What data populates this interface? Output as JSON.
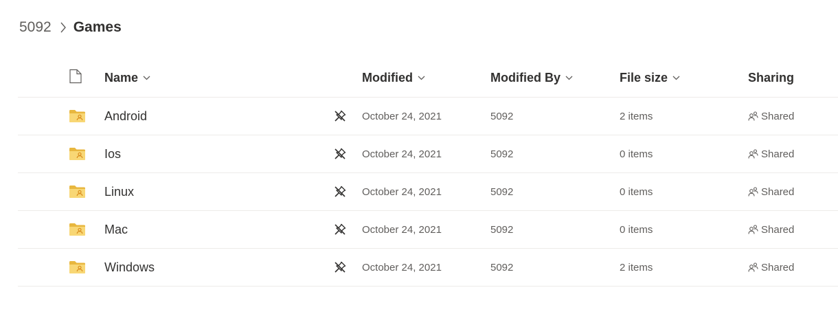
{
  "breadcrumb": {
    "root": "5092",
    "current": "Games"
  },
  "columns": {
    "name": "Name",
    "modified": "Modified",
    "modified_by": "Modified By",
    "file_size": "File size",
    "sharing": "Sharing"
  },
  "icons": {
    "file_header": "file-icon",
    "folder": "shared-folder-icon",
    "flag": "not-following-icon",
    "sharing": "people-icon",
    "chevron": "chevron-down-icon",
    "separator": "chevron-right-icon"
  },
  "colors": {
    "folder": "#f8d775",
    "folder_dark": "#e8b73f",
    "folder_people": "#d98c1c",
    "divider": "#edebe9"
  },
  "rows": [
    {
      "name": "Android",
      "modified": "October 24, 2021",
      "modified_by": "5092",
      "file_size": "2 items",
      "sharing": "Shared"
    },
    {
      "name": "Ios",
      "modified": "October 24, 2021",
      "modified_by": "5092",
      "file_size": "0 items",
      "sharing": "Shared"
    },
    {
      "name": "Linux",
      "modified": "October 24, 2021",
      "modified_by": "5092",
      "file_size": "0 items",
      "sharing": "Shared"
    },
    {
      "name": "Mac",
      "modified": "October 24, 2021",
      "modified_by": "5092",
      "file_size": "0 items",
      "sharing": "Shared"
    },
    {
      "name": "Windows",
      "modified": "October 24, 2021",
      "modified_by": "5092",
      "file_size": "2 items",
      "sharing": "Shared"
    }
  ]
}
